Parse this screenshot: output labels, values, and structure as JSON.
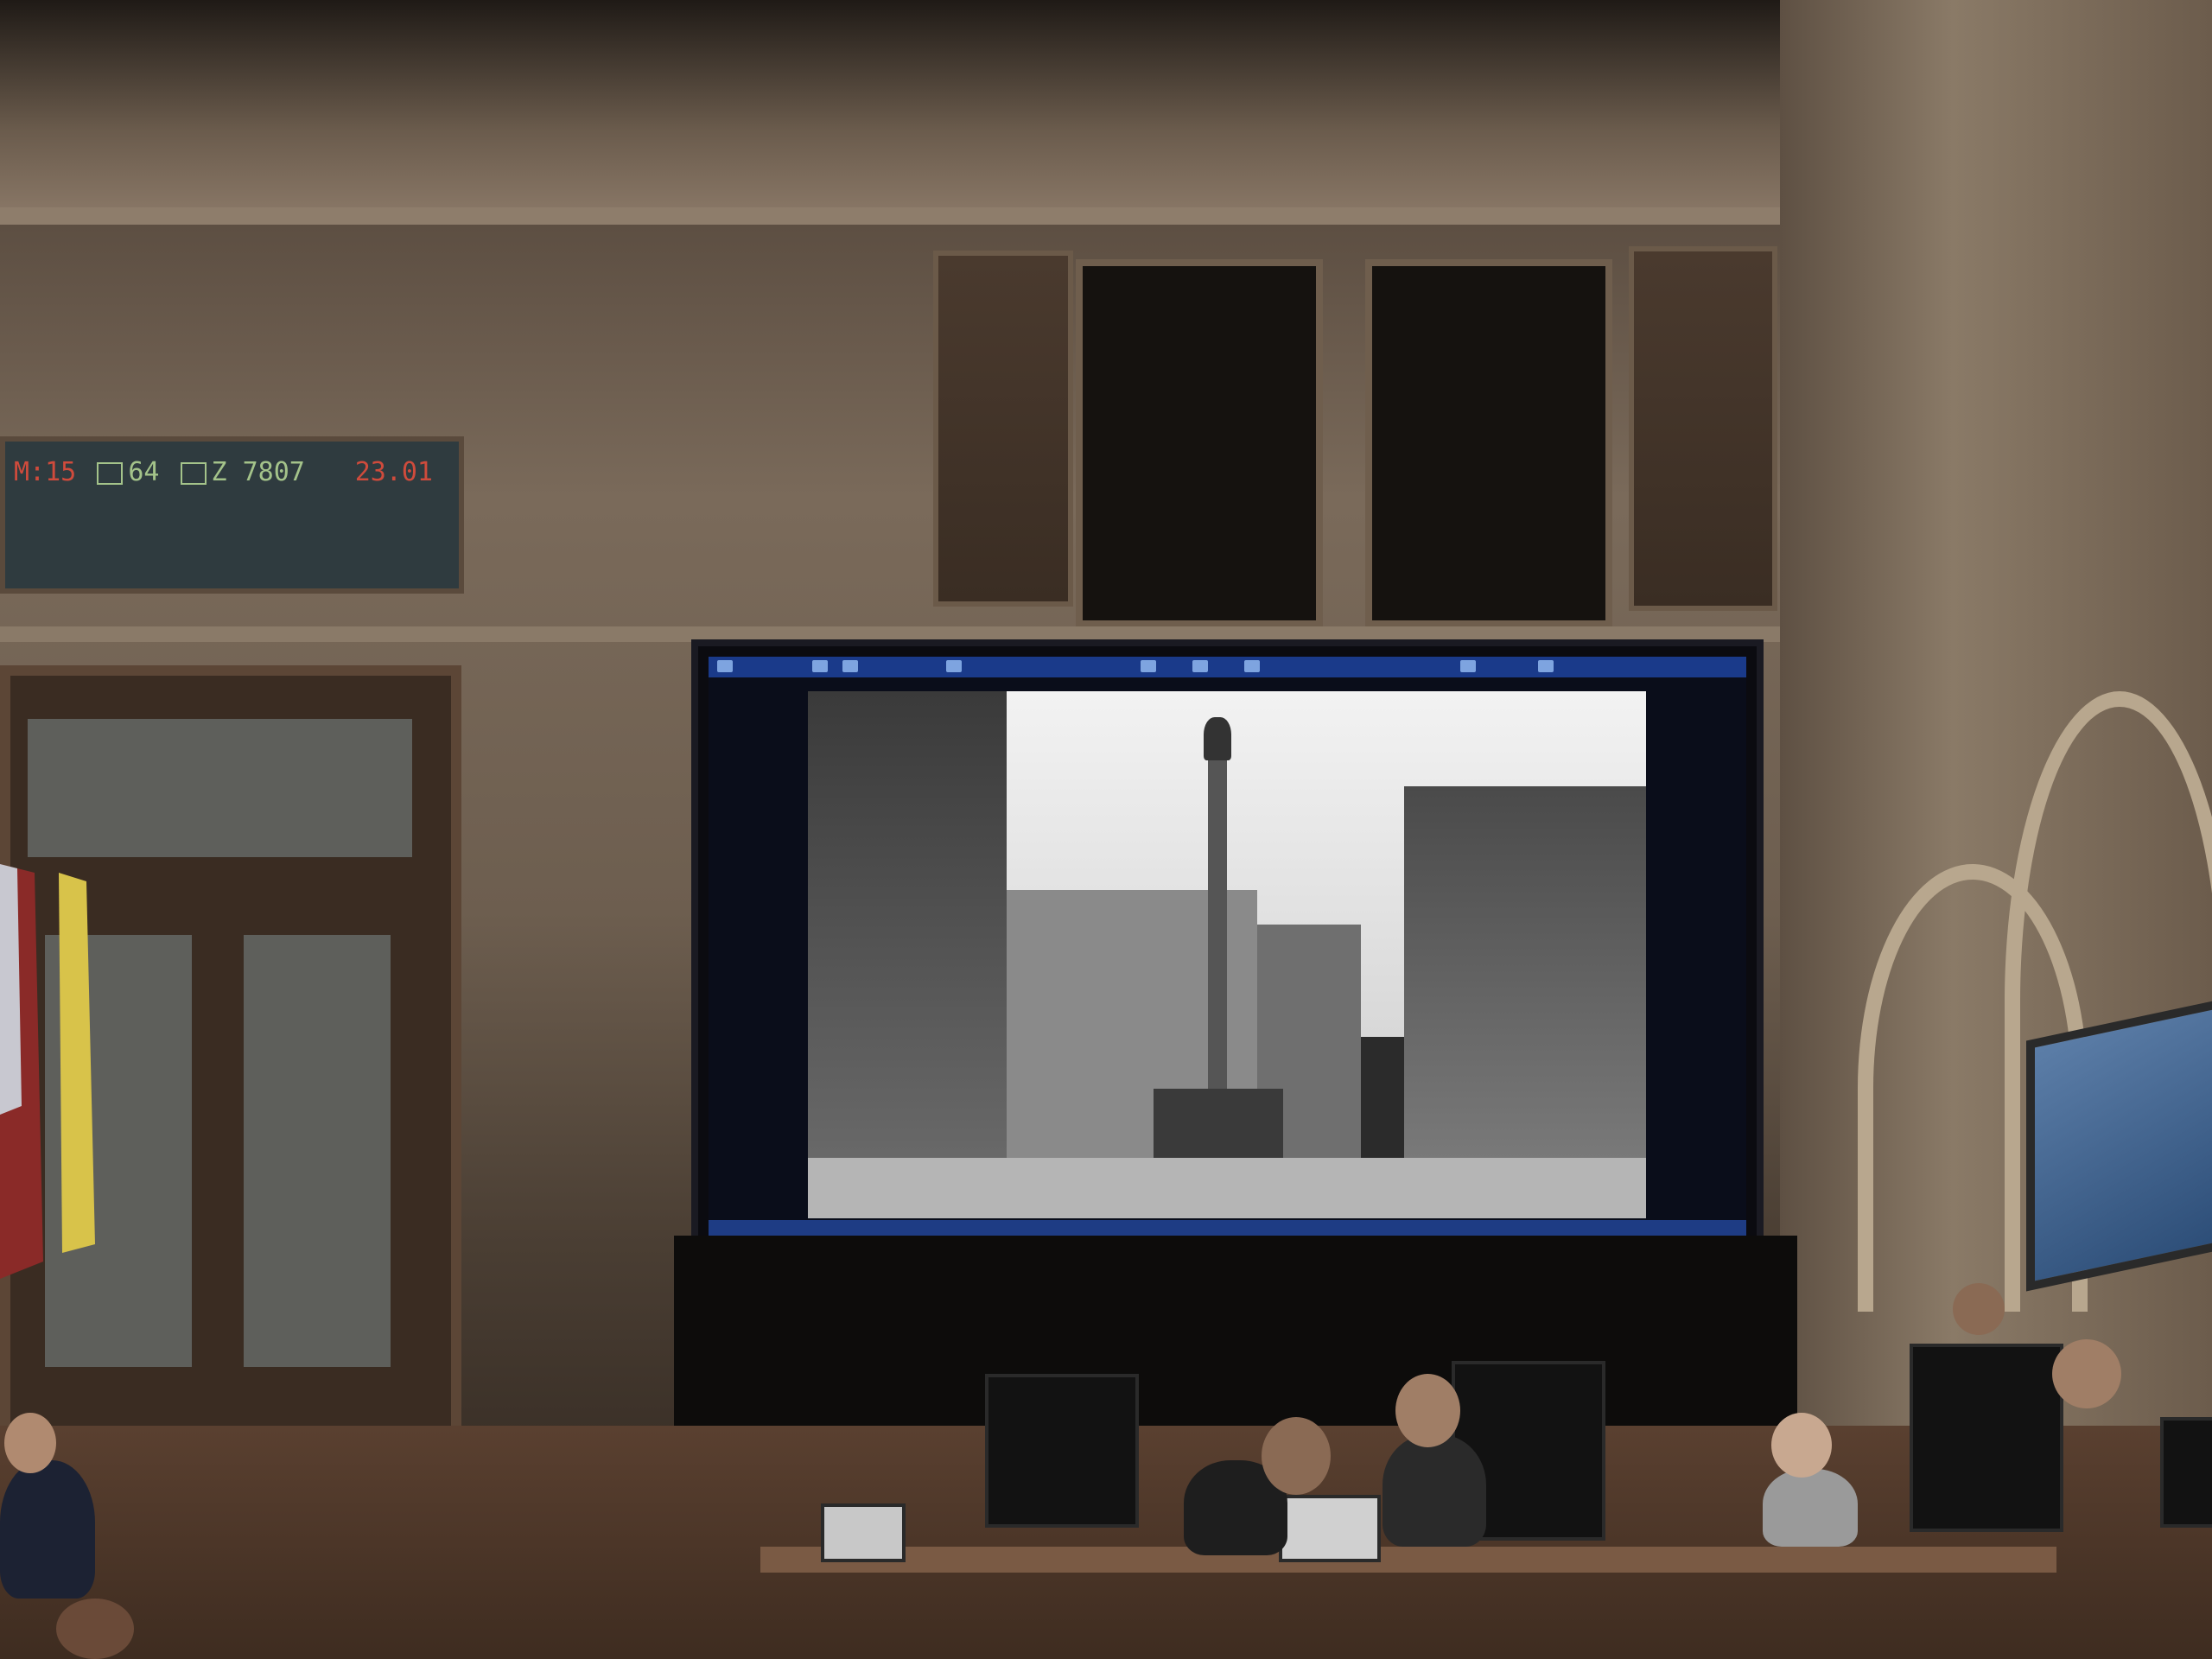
{
  "ticker": {
    "left_text": "M:15",
    "count1": "64",
    "count2": "Z 7807",
    "right_text": "23.01"
  },
  "screen": {
    "content": "Black-and-white historical photo of a town square with a column monument",
    "photo_alt": "Old Town Square photograph"
  },
  "colors": {
    "ticker_green": "#a4c38a",
    "ticker_red": "#cf4b3c",
    "titlebar_blue": "#1a3a8a"
  },
  "icons": [
    "checkbox-icon",
    "book-icon"
  ]
}
